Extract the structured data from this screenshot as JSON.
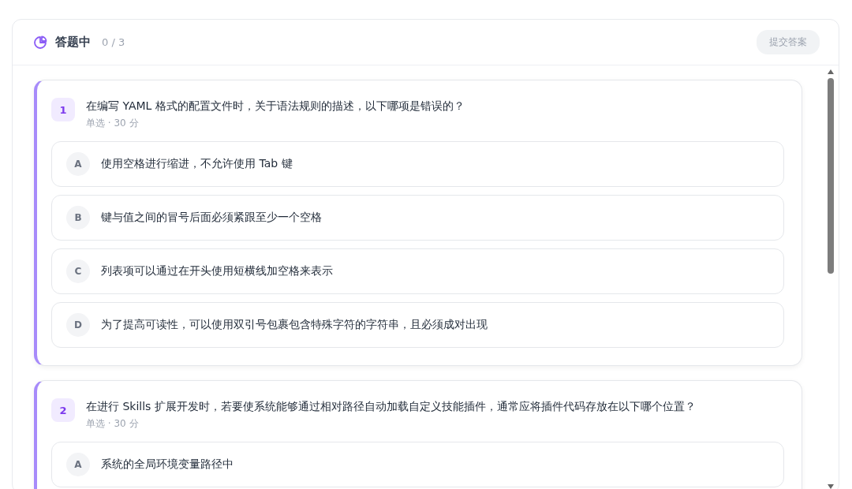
{
  "header": {
    "title": "答题中",
    "progress": "0 / 3",
    "submit_button": "提交答案"
  },
  "questions": [
    {
      "number": "1",
      "text": "在编写 YAML 格式的配置文件时，关于语法规则的描述，以下哪项是错误的？",
      "meta": "单选 · 30 分",
      "options": [
        {
          "letter": "A",
          "text": "使用空格进行缩进，不允许使用 Tab 键"
        },
        {
          "letter": "B",
          "text": "键与值之间的冒号后面必须紧跟至少一个空格"
        },
        {
          "letter": "C",
          "text": "列表项可以通过在开头使用短横线加空格来表示"
        },
        {
          "letter": "D",
          "text": "为了提高可读性，可以使用双引号包裹包含特殊字符的字符串，且必须成对出现"
        }
      ]
    },
    {
      "number": "2",
      "text": "在进行 Skills 扩展开发时，若要使系统能够通过相对路径自动加载自定义技能插件，通常应将插件代码存放在以下哪个位置？",
      "meta": "单选 · 30 分",
      "options": [
        {
          "letter": "A",
          "text": "系统的全局环境变量路径中"
        }
      ]
    }
  ]
}
